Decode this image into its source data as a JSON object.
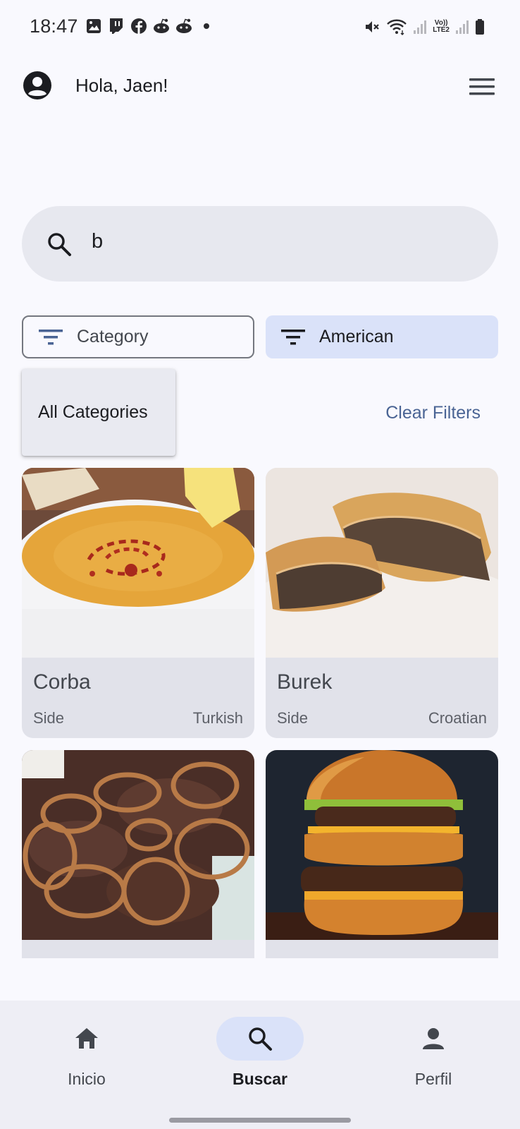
{
  "status_bar": {
    "time": "18:47",
    "left_icons": [
      "gallery-icon",
      "twitch-icon",
      "facebook-icon",
      "reddit-icon",
      "reddit-icon",
      "dot-icon"
    ],
    "right_icons": [
      "mute-icon",
      "wifi-icon",
      "signal-icon",
      "volte-icon",
      "signal-icon",
      "battery-icon"
    ],
    "volte_label_top": "Vo))",
    "volte_label_bottom": "LTE2"
  },
  "header": {
    "greeting": "Hola, Jaen!",
    "avatar_icon": "account-circle-icon",
    "menu_icon": "menu-icon"
  },
  "search": {
    "value": "b",
    "icon": "search-icon"
  },
  "filters": {
    "category_label": "Category",
    "area_label": "American",
    "icon": "filter-icon"
  },
  "dropdown": {
    "items": [
      "All Categories"
    ]
  },
  "clear_filters_label": "Clear Filters",
  "cards": [
    {
      "title": "Corba",
      "category": "Side",
      "area": "Turkish"
    },
    {
      "title": "Burek",
      "category": "Side",
      "area": "Croatian"
    },
    {
      "title": "",
      "category": "",
      "area": ""
    },
    {
      "title": "",
      "category": "",
      "area": ""
    }
  ],
  "bottom_nav": {
    "items": [
      {
        "label": "Inicio",
        "icon": "home-icon",
        "active": false
      },
      {
        "label": "Buscar",
        "icon": "search-icon",
        "active": true
      },
      {
        "label": "Perfil",
        "icon": "person-icon",
        "active": false
      }
    ]
  },
  "colors": {
    "background": "#f9f9fe",
    "search_bg": "#e7e8ef",
    "selected_chip": "#dae2f9",
    "accent_text": "#4a6494",
    "card_bg": "#e1e2ea",
    "nav_bg": "#eeeef5"
  }
}
